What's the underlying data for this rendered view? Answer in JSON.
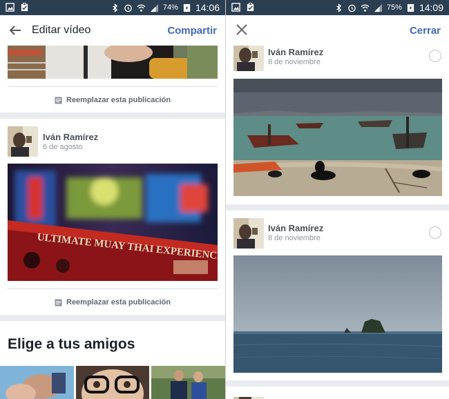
{
  "left": {
    "status": {
      "battery": "74%",
      "time": "14:06"
    },
    "header": {
      "title": "Editar vídeo",
      "action": "Compartir"
    },
    "replace_label_1": "Reemplazar esta publicación",
    "post": {
      "author": "Iván Ramírez",
      "date": "6 de agosto",
      "sign_text": "ULTIMATE MUAY THAI EXPERIENCE"
    },
    "replace_label_2": "Reemplazar esta publicación",
    "friends_title": "Elige a tus amigos"
  },
  "right": {
    "status": {
      "battery": "75%",
      "time": "14:09"
    },
    "header": {
      "action": "Cerrar"
    },
    "posts": [
      {
        "author": "Iván Ramírez",
        "date": "8 de noviembre"
      },
      {
        "author": "Iván Ramírez",
        "date": "8 de noviembre"
      }
    ]
  },
  "colors": {
    "statusbar": "#2c3e52",
    "accent": "#4267b2",
    "separator": "#e9ebee"
  },
  "icons": [
    "gallery-icon",
    "clipboard-icon",
    "bluetooth-icon",
    "alarm-icon",
    "wifi-icon",
    "signal-icon",
    "battery-icon",
    "back-arrow-icon",
    "close-icon",
    "document-icon"
  ]
}
